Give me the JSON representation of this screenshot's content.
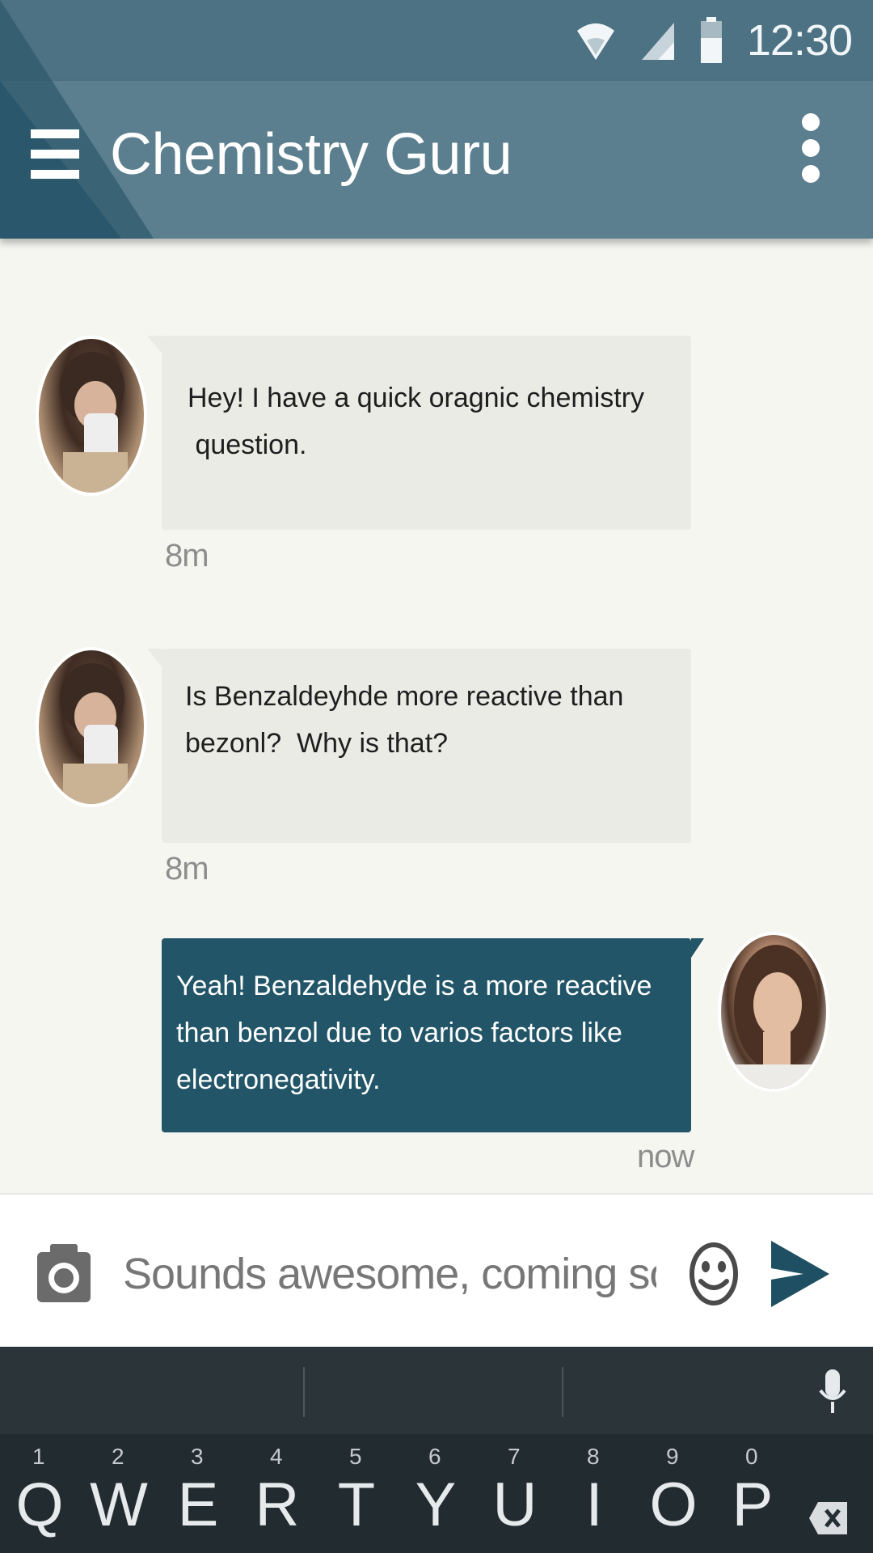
{
  "status_bar": {
    "time": "12:30",
    "icons": [
      "wifi-icon",
      "cell-signal-icon",
      "battery-icon"
    ]
  },
  "app_bar": {
    "title": "Chemistry Guru",
    "menu_icon": "hamburger-menu-icon",
    "overflow_icon": "more-vertical-icon"
  },
  "messages": [
    {
      "direction": "incoming",
      "avatar": "user-avatar-girl",
      "lines": [
        "Hey! I have a quick oragnic chemistry",
        " question."
      ],
      "time": "8m"
    },
    {
      "direction": "incoming",
      "avatar": "user-avatar-girl",
      "lines": [
        "Is Benzaldeyhde more reactive than",
        "bezonl?  Why is that?"
      ],
      "time": "8m"
    },
    {
      "direction": "outgoing",
      "avatar": "tutor-avatar-woman",
      "lines": [
        "Yeah! Benzaldehyde is a more reactive",
        "than benzol due to varios factors like",
        "electronegativity."
      ],
      "time": "now"
    }
  ],
  "composer": {
    "placeholder": "Sounds awesome, coming soon!",
    "camera_icon": "camera-icon",
    "emoji_icon": "emoji-icon",
    "send_icon": "send-icon"
  },
  "keyboard": {
    "mic_icon": "microphone-icon",
    "keys": [
      {
        "num": "1",
        "letter": "Q"
      },
      {
        "num": "2",
        "letter": "W"
      },
      {
        "num": "3",
        "letter": "E"
      },
      {
        "num": "4",
        "letter": "R"
      },
      {
        "num": "5",
        "letter": "T"
      },
      {
        "num": "6",
        "letter": "Y"
      },
      {
        "num": "7",
        "letter": "U"
      },
      {
        "num": "8",
        "letter": "I"
      },
      {
        "num": "9",
        "letter": "O"
      },
      {
        "num": "0",
        "letter": "P"
      }
    ],
    "backspace_icon": "backspace-icon"
  },
  "colors": {
    "status_bar": "#4d7283",
    "app_bar": "#5b7f8e",
    "incoming_bubble": "#ebebe6",
    "outgoing_bubble": "#225568",
    "chat_background": "#f6f6f1",
    "keyboard": "#242e33"
  }
}
